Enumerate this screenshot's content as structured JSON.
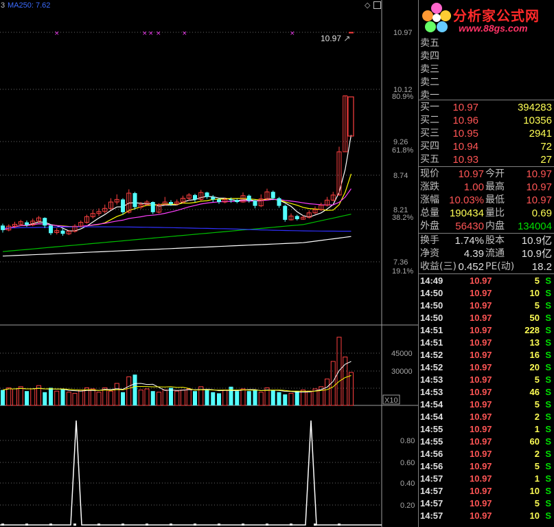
{
  "header": {
    "left_code": "3",
    "ma_label": "MA250: 7.62",
    "icons": [
      "diamond-icon",
      "window-restore-icon"
    ]
  },
  "main_chart": {
    "high_marker": "10.97",
    "price_axis": [
      "10.97",
      "10.12",
      "9.26",
      "8.74",
      "8.21",
      "7.36"
    ],
    "pct_axis": [
      "80.9%",
      "61.8%",
      "38.2%",
      "19.1%"
    ]
  },
  "volume_chart": {
    "axis": [
      "45000",
      "30000"
    ],
    "unit": "X10"
  },
  "indicator_chart": {
    "axis": [
      "0.80",
      "0.60",
      "0.40",
      "0.20"
    ]
  },
  "colors": {
    "up": "#ff4040",
    "down": "#54ffff",
    "ma5": "#ffffff",
    "ma10": "#ffff00",
    "ma20": "#ff40ff",
    "ma60": "#00c000",
    "ma120": "#3030ff",
    "ma250": "#ffffff"
  },
  "logo": {
    "title": "分析家公式网",
    "url": "www.88gs.com"
  },
  "sell_orders": [
    {
      "label": "卖五",
      "price": "",
      "vol": ""
    },
    {
      "label": "卖四",
      "price": "",
      "vol": ""
    },
    {
      "label": "卖三",
      "price": "",
      "vol": ""
    },
    {
      "label": "卖二",
      "price": "",
      "vol": ""
    },
    {
      "label": "卖一",
      "price": "",
      "vol": ""
    }
  ],
  "buy_orders": [
    {
      "label": "买一",
      "price": "10.97",
      "vol": "394283"
    },
    {
      "label": "买二",
      "price": "10.96",
      "vol": "10356"
    },
    {
      "label": "买三",
      "price": "10.95",
      "vol": "2941"
    },
    {
      "label": "买四",
      "price": "10.94",
      "vol": "72"
    },
    {
      "label": "买五",
      "price": "10.93",
      "vol": "27"
    }
  ],
  "quote": [
    {
      "l1": "现价",
      "v1": "10.97",
      "l2": "今开",
      "v2": "10.97"
    },
    {
      "l1": "涨跌",
      "v1": "1.00",
      "l2": "最高",
      "v2": "10.97"
    },
    {
      "l1": "涨幅",
      "v1": "10.03%",
      "l2": "最低",
      "v2": "10.97"
    },
    {
      "l1": "总量",
      "v1": "190434",
      "l2": "量比",
      "v2": "0.69"
    },
    {
      "l1": "外盘",
      "v1": "56430",
      "l2": "内盘",
      "v2": "134004"
    }
  ],
  "finance": [
    {
      "l1": "换手",
      "v1": "1.74%",
      "l2": "股本",
      "v2": "10.9亿"
    },
    {
      "l1": "净资",
      "v1": "4.39",
      "l2": "流通",
      "v2": "10.9亿"
    },
    {
      "l1": "收益(三)",
      "v1": "0.452",
      "l2": "PE(动)",
      "v2": "18.2"
    }
  ],
  "ticks": [
    {
      "time": "14:49",
      "price": "10.97",
      "vol": "5",
      "side": "S"
    },
    {
      "time": "14:50",
      "price": "10.97",
      "vol": "10",
      "side": "S"
    },
    {
      "time": "14:50",
      "price": "10.97",
      "vol": "5",
      "side": "S"
    },
    {
      "time": "14:50",
      "price": "10.97",
      "vol": "50",
      "side": "S"
    },
    {
      "time": "14:51",
      "price": "10.97",
      "vol": "228",
      "side": "S"
    },
    {
      "time": "14:51",
      "price": "10.97",
      "vol": "13",
      "side": "S"
    },
    {
      "time": "14:52",
      "price": "10.97",
      "vol": "16",
      "side": "S"
    },
    {
      "time": "14:52",
      "price": "10.97",
      "vol": "20",
      "side": "S"
    },
    {
      "time": "14:53",
      "price": "10.97",
      "vol": "5",
      "side": "S"
    },
    {
      "time": "14:53",
      "price": "10.97",
      "vol": "46",
      "side": "S"
    },
    {
      "time": "14:54",
      "price": "10.97",
      "vol": "5",
      "side": "S"
    },
    {
      "time": "14:54",
      "price": "10.97",
      "vol": "2",
      "side": "S"
    },
    {
      "time": "14:55",
      "price": "10.97",
      "vol": "1",
      "side": "S"
    },
    {
      "time": "14:55",
      "price": "10.97",
      "vol": "60",
      "side": "S"
    },
    {
      "time": "14:56",
      "price": "10.97",
      "vol": "2",
      "side": "S"
    },
    {
      "time": "14:56",
      "price": "10.97",
      "vol": "5",
      "side": "S"
    },
    {
      "time": "14:57",
      "price": "10.97",
      "vol": "1",
      "side": "S"
    },
    {
      "time": "14:57",
      "price": "10.97",
      "vol": "10",
      "side": "S"
    },
    {
      "time": "14:57",
      "price": "10.97",
      "vol": "5",
      "side": "S"
    },
    {
      "time": "14:57",
      "price": "10.97",
      "vol": "10",
      "side": "S"
    }
  ]
}
